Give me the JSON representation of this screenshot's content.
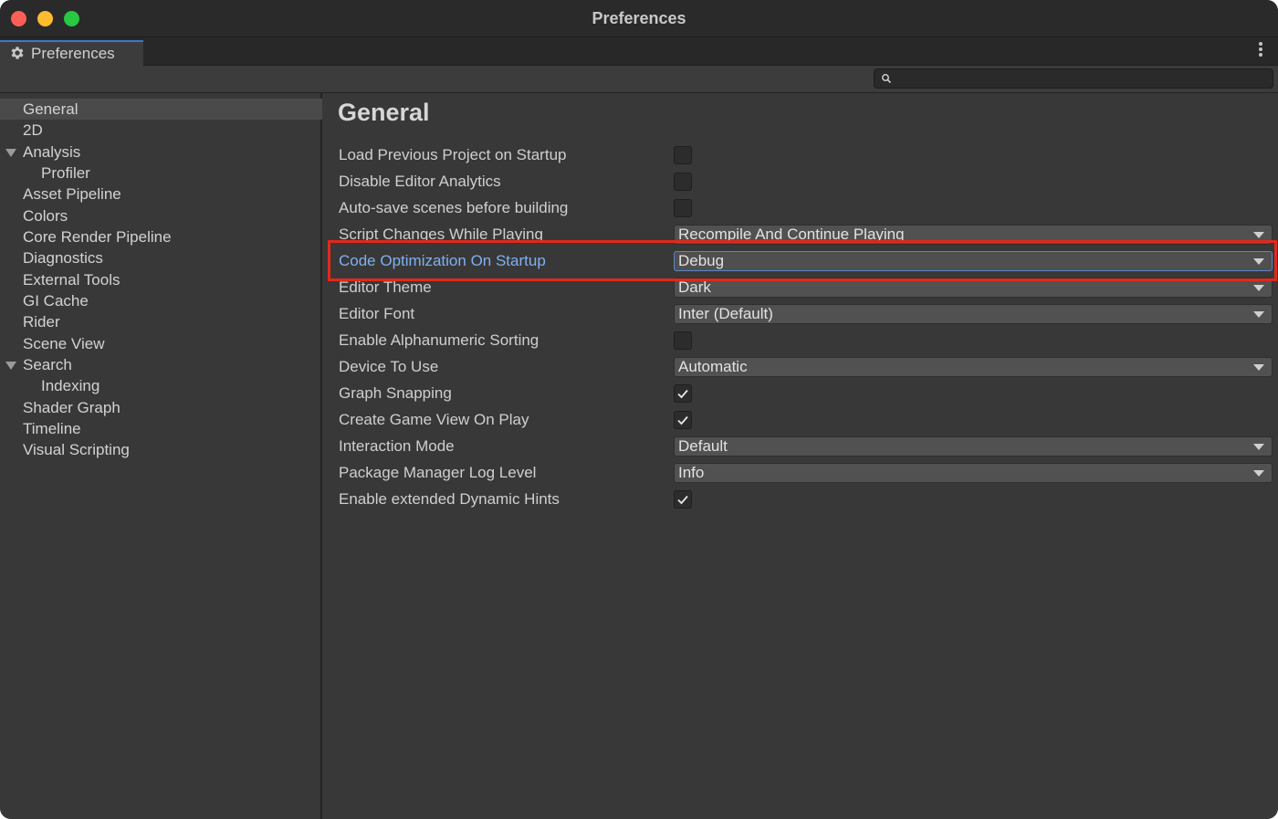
{
  "window": {
    "title": "Preferences"
  },
  "tab": {
    "label": "Preferences",
    "icon": "gear-icon"
  },
  "search": {
    "value": "",
    "placeholder": ""
  },
  "sidebar": {
    "items": [
      {
        "label": "General",
        "selected": true,
        "expandable": false,
        "indent": 0
      },
      {
        "label": "2D",
        "selected": false,
        "expandable": false,
        "indent": 0
      },
      {
        "label": "Analysis",
        "selected": false,
        "expandable": true,
        "indent": 0
      },
      {
        "label": "Profiler",
        "selected": false,
        "expandable": false,
        "indent": 1
      },
      {
        "label": "Asset Pipeline",
        "selected": false,
        "expandable": false,
        "indent": 0
      },
      {
        "label": "Colors",
        "selected": false,
        "expandable": false,
        "indent": 0
      },
      {
        "label": "Core Render Pipeline",
        "selected": false,
        "expandable": false,
        "indent": 0
      },
      {
        "label": "Diagnostics",
        "selected": false,
        "expandable": false,
        "indent": 0
      },
      {
        "label": "External Tools",
        "selected": false,
        "expandable": false,
        "indent": 0
      },
      {
        "label": "GI Cache",
        "selected": false,
        "expandable": false,
        "indent": 0
      },
      {
        "label": "Rider",
        "selected": false,
        "expandable": false,
        "indent": 0
      },
      {
        "label": "Scene View",
        "selected": false,
        "expandable": false,
        "indent": 0
      },
      {
        "label": "Search",
        "selected": false,
        "expandable": true,
        "indent": 0
      },
      {
        "label": "Indexing",
        "selected": false,
        "expandable": false,
        "indent": 1
      },
      {
        "label": "Shader Graph",
        "selected": false,
        "expandable": false,
        "indent": 0
      },
      {
        "label": "Timeline",
        "selected": false,
        "expandable": false,
        "indent": 0
      },
      {
        "label": "Visual Scripting",
        "selected": false,
        "expandable": false,
        "indent": 0
      }
    ]
  },
  "main": {
    "title": "General",
    "settings": [
      {
        "label": "Load Previous Project on Startup",
        "type": "checkbox",
        "checked": false
      },
      {
        "label": "Disable Editor Analytics",
        "type": "checkbox",
        "checked": false
      },
      {
        "label": "Auto-save scenes before building",
        "type": "checkbox",
        "checked": false
      },
      {
        "label": "Script Changes While Playing",
        "type": "dropdown",
        "value": "Recompile And Continue Playing"
      },
      {
        "label": "Code Optimization On Startup",
        "type": "dropdown",
        "value": "Debug",
        "highlighted": true
      },
      {
        "label": "Editor Theme",
        "type": "dropdown",
        "value": "Dark"
      },
      {
        "label": "Editor Font",
        "type": "dropdown",
        "value": "Inter (Default)"
      },
      {
        "label": "Enable Alphanumeric Sorting",
        "type": "checkbox",
        "checked": false
      },
      {
        "label": "Device To Use",
        "type": "dropdown",
        "value": "Automatic"
      },
      {
        "label": "Graph Snapping",
        "type": "checkbox",
        "checked": true
      },
      {
        "label": "Create Game View On Play",
        "type": "checkbox",
        "checked": true
      },
      {
        "label": "Interaction Mode",
        "type": "dropdown",
        "value": "Default"
      },
      {
        "label": "Package Manager Log Level",
        "type": "dropdown",
        "value": "Info"
      },
      {
        "label": "Enable extended Dynamic Hints",
        "type": "checkbox",
        "checked": true
      }
    ]
  },
  "colors": {
    "accent": "#3a78c8",
    "highlight_label": "#7fb0f0",
    "annotation": "#e0291b"
  }
}
